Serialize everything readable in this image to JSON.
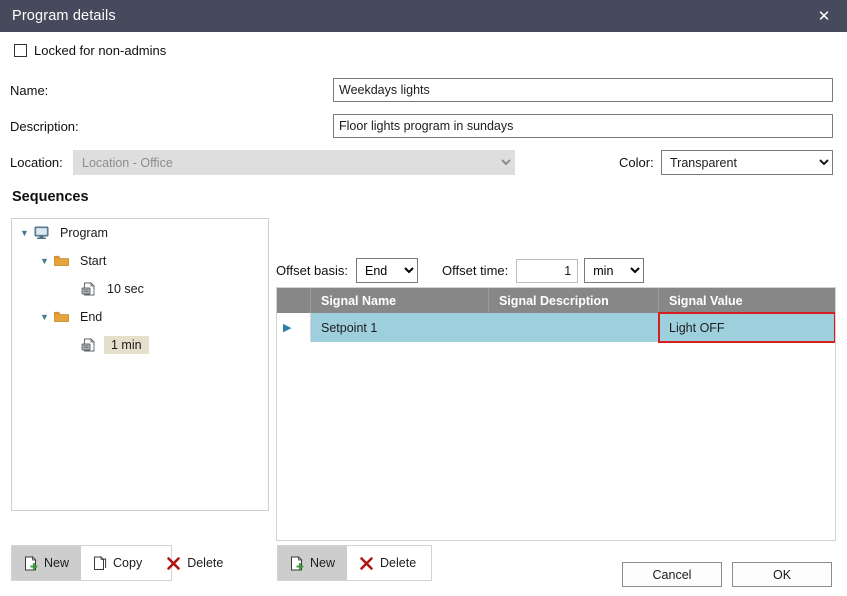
{
  "window": {
    "title": "Program details",
    "close_icon": "close-icon"
  },
  "form": {
    "locked_checkbox_label": "Locked for non-admins",
    "locked_checked": false,
    "name_label": "Name:",
    "name_value": "Weekdays lights",
    "description_label": "Description:",
    "description_value": "Floor lights program in sundays",
    "location_label": "Location:",
    "location_value": "Location - Office",
    "location_disabled": true,
    "color_label": "Color:",
    "color_value": "Transparent"
  },
  "sequences": {
    "heading": "Sequences",
    "tree": [
      {
        "label": "Program",
        "level": 0,
        "icon": "monitor-icon",
        "expanded": true,
        "selected": false
      },
      {
        "label": "Start",
        "level": 1,
        "icon": "folder-icon",
        "expanded": true,
        "selected": false
      },
      {
        "label": "10 sec",
        "level": 2,
        "icon": "schedule-icon",
        "expanded": null,
        "selected": false
      },
      {
        "label": "End",
        "level": 1,
        "icon": "folder-icon",
        "expanded": true,
        "selected": false
      },
      {
        "label": "1 min",
        "level": 2,
        "icon": "schedule-icon",
        "expanded": null,
        "selected": true
      }
    ],
    "toolbar": {
      "new_label": "New",
      "copy_label": "Copy",
      "delete_label": "Delete"
    }
  },
  "offset": {
    "basis_label": "Offset basis:",
    "basis_value": "End",
    "time_label": "Offset time:",
    "time_value": "1",
    "unit_value": "min"
  },
  "grid": {
    "columns": [
      "Signal Name",
      "Signal Description",
      "Signal Value"
    ],
    "rows": [
      {
        "indicator": "▶",
        "signal_name": "Setpoint 1",
        "signal_description": "",
        "signal_value": "Light OFF",
        "selected": true,
        "value_highlighted": true
      }
    ],
    "toolbar": {
      "new_label": "New",
      "delete_label": "Delete"
    }
  },
  "footer": {
    "cancel_label": "Cancel",
    "ok_label": "OK"
  },
  "colors": {
    "titlebar": "#474a5c",
    "row_selected": "#9ecfdd",
    "header_gray": "#878787",
    "highlight_red": "#d81f1f",
    "tree_selected": "#e6dfcc"
  }
}
